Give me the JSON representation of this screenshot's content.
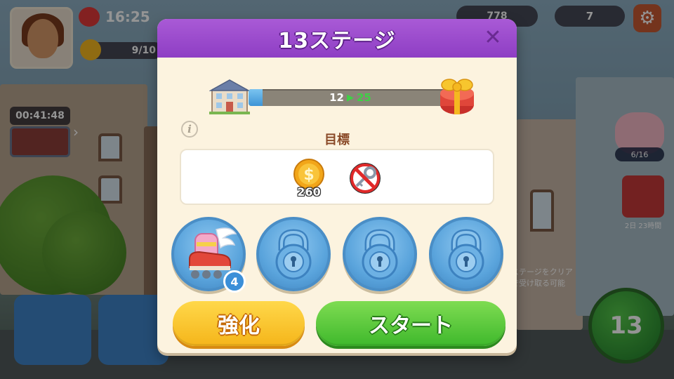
{
  "hud": {
    "time": "16:25",
    "level": "9/10",
    "timer": "00:41:48",
    "coins": "778",
    "gems": "7",
    "piggy_progress": "6/16",
    "gift_timer": "2日 23時間",
    "clear_note": "ステージをクリア\nで受け取る可能",
    "current_stage_button": "13"
  },
  "modal": {
    "title": "13ステージ",
    "close_glyph": "✕",
    "progress": {
      "current": "12",
      "arrow": "▶",
      "target": "25",
      "fill_fraction": 0.07
    },
    "goal_title": "目標",
    "goals": {
      "coin_value": "260",
      "no_key_label": "no-key"
    },
    "boosters": {
      "skate_count": "4"
    },
    "buttons": {
      "upgrade": "強化",
      "start": "スタート"
    },
    "colors": {
      "header": "#9a4ccc",
      "start": "#4fc436",
      "upgrade": "#f7c327",
      "booster": "#5aa4dc"
    }
  }
}
